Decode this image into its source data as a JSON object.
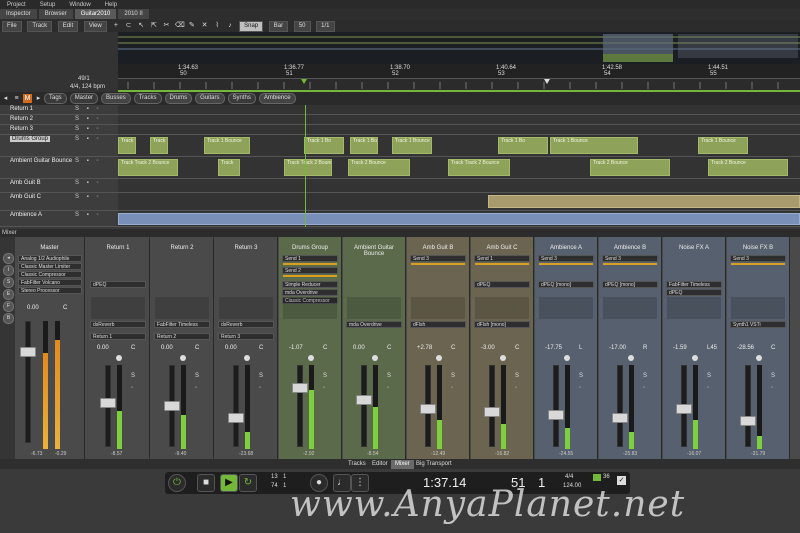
{
  "menu": [
    "Project",
    "Setup",
    "Window",
    "Help"
  ],
  "tabs": [
    {
      "label": "Inspector",
      "active": false
    },
    {
      "label": "Browser",
      "active": false
    },
    {
      "label": "Guitar2010",
      "active": true
    },
    {
      "label": "2010 II",
      "active": false
    }
  ],
  "toolbar": {
    "file": "File",
    "track": "Track",
    "edit": "Edit",
    "view": "View",
    "snap": "Snap",
    "bar": "Bar",
    "quantize": "50",
    "division": "1/1"
  },
  "position": {
    "bars": "49/1",
    "meter_tempo": "4/4, 124 bpm"
  },
  "ruler_marks": [
    "1:34.63",
    "50",
    "1:36.77",
    "51",
    "1:38.70",
    "52",
    "1:40.64",
    "53",
    "1:42.58",
    "54",
    "1:44.51",
    "55"
  ],
  "filters": {
    "tags": "Tags",
    "items": [
      {
        "label": "Master",
        "on": false
      },
      {
        "label": "Busses",
        "on": true
      },
      {
        "label": "Tracks",
        "on": false
      },
      {
        "label": "Drums",
        "on": true
      },
      {
        "label": "Guitars",
        "on": true
      },
      {
        "label": "Synths",
        "on": false
      },
      {
        "label": "Ambience",
        "on": true
      }
    ]
  },
  "tracks": [
    {
      "name": "Return 1",
      "clips": []
    },
    {
      "name": "Return 2",
      "clips": []
    },
    {
      "name": "Return 3",
      "clips": []
    },
    {
      "name": "Drums Group",
      "clips": [
        "Track 1 Bounce",
        "Track 1 Bounce",
        "Track 1 Bounce",
        "Track 1 Bo",
        "Track 1 Bou",
        "Track 1 Bounce",
        "Track 1 Bo",
        "Track 1 Bounce",
        "Track 1 Bounce"
      ]
    },
    {
      "name": "Ambient Guitar Bounce",
      "clips": [
        "Track Track 2 Bounce",
        "Track",
        "Track Track 2 Bounce",
        "Track 2 Bounce",
        "Track Track 2 Bounce",
        "Track 2 Bounce",
        "Track 2 Bounce"
      ]
    },
    {
      "name": "Amb Guit B",
      "clips": []
    },
    {
      "name": "Amb Guit C",
      "clips": []
    },
    {
      "name": "Ambience A",
      "clips": []
    }
  ],
  "mixer": {
    "label": "Mixer",
    "master": {
      "name": "Master",
      "inserts": [
        "Analog 1/2 Audiophile",
        "Classic Master Limiter",
        "Classic Compressor",
        "FabFilter Volcano",
        "Stereo Processor"
      ],
      "gain": "0.00",
      "pan": "C",
      "peak_l": "-6.73",
      "peak_r": "-0.29",
      "meter": 0.8
    },
    "strips": [
      {
        "name": "Return 1",
        "sends": [],
        "inserts": [
          "dPEQ"
        ],
        "insert2": "dsReverb",
        "output": "Return 1",
        "gain": "0.00",
        "pan": "C",
        "peak": "-8.57",
        "meter": 0.45,
        "color": "#4a4a4a"
      },
      {
        "name": "Return 2",
        "sends": [],
        "inserts": [],
        "insert2": "FabFilter Timeless",
        "output": "Return 2",
        "gain": "0.00",
        "pan": "C",
        "peak": "-9.40",
        "meter": 0.4,
        "color": "#4a4a4a"
      },
      {
        "name": "Return 3",
        "sends": [],
        "inserts": [],
        "insert2": "dsReverb",
        "output": "Return 3",
        "gain": "0.00",
        "pan": "C",
        "peak": "-23.68",
        "meter": 0.2,
        "color": "#4a4a4a"
      },
      {
        "name": "Drums Group",
        "sends": [
          "Send 1",
          "Send 2"
        ],
        "inserts": [
          "Simple Reducer",
          "mda Overdrive",
          "Classic Compressor"
        ],
        "insert2": "",
        "output": "",
        "gain": "-1.07",
        "pan": "C",
        "peak": "-2.92",
        "meter": 0.7,
        "color": "#5a6a4a"
      },
      {
        "name": "Ambient Guitar Bounce",
        "sends": [],
        "inserts": [],
        "insert2": "mda Overdrive",
        "output": "",
        "gain": "0.00",
        "pan": "C",
        "peak": "-8.54",
        "meter": 0.5,
        "color": "#5a6a4a"
      },
      {
        "name": "Amb Guit B",
        "sends": [
          "Send 3"
        ],
        "inserts": [],
        "insert2": "dFlsh",
        "output": "",
        "gain": "+2.78",
        "pan": "C",
        "peak": "-12.49",
        "meter": 0.35,
        "color": "#6b6450"
      },
      {
        "name": "Amb Guit C",
        "sends": [
          "Send 1"
        ],
        "inserts": [
          "dPEQ"
        ],
        "insert2": "dFlsh [mono]",
        "output": "",
        "gain": "-3.00",
        "pan": "C",
        "peak": "-16.82",
        "meter": 0.3,
        "color": "#6b6450"
      },
      {
        "name": "Ambience A",
        "sends": [
          "Send 3"
        ],
        "inserts": [
          "dPEQ [mono]"
        ],
        "insert2": "",
        "output": "",
        "gain": "-17.75",
        "pan": "L",
        "peak": "-24.55",
        "meter": 0.25,
        "color": "#56606e"
      },
      {
        "name": "Ambience B",
        "sends": [
          "Send 3"
        ],
        "inserts": [
          "dPEQ [mono]"
        ],
        "insert2": "",
        "output": "",
        "gain": "-17.00",
        "pan": "R",
        "peak": "-25.83",
        "meter": 0.2,
        "color": "#56606e"
      },
      {
        "name": "Noise FX A",
        "sends": [],
        "inserts": [
          "FabFilter Timeless",
          "dPEQ"
        ],
        "insert2": "",
        "output": "",
        "gain": "-1.59",
        "pan": "L45",
        "peak": "-16.07",
        "meter": 0.35,
        "color": "#56606e"
      },
      {
        "name": "Noise FX B",
        "sends": [
          "Send 3"
        ],
        "inserts": [],
        "insert2": "Synth1 VSTi",
        "output": "",
        "gain": "-28.56",
        "pan": "C",
        "peak": "-31.79",
        "meter": 0.15,
        "color": "#56606e"
      }
    ]
  },
  "view_tabs": [
    {
      "label": "Tracks",
      "active": false
    },
    {
      "label": "Editor",
      "active": false
    },
    {
      "label": "Mixer",
      "active": true
    },
    {
      "label": "Big Transport",
      "active": false
    }
  ],
  "transport": {
    "loop_start": "13",
    "loop_start2": "1",
    "loop_end": "74",
    "loop_end2": "1",
    "time": "1:37.14",
    "bars": "51",
    "beat": "1",
    "signature": "4/4",
    "tempo": "124.00",
    "metronome_count": "36"
  },
  "watermark": "www.AnyaPlanet.net",
  "colors": {
    "accent_green": "#74b83a",
    "clip_green": "#8ea25a",
    "ambience_blue": "#7a8fb8"
  }
}
